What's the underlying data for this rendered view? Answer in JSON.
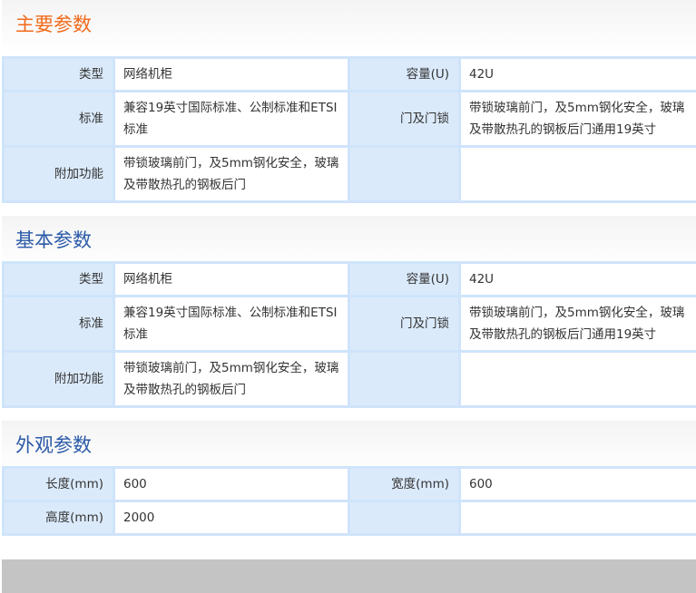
{
  "sections": [
    {
      "title": "主要参数",
      "rows": [
        {
          "label1": "类型",
          "value1": "网络机柜",
          "label2": "容量(U)",
          "value2": "42U"
        },
        {
          "label1": "标准",
          "value1": "兼容19英寸国际标准、公制标准和ETSI标准",
          "label2": "门及门锁",
          "value2": "带锁玻璃前门，及5mm钢化安全，玻璃及带散热孔的钢板后门通用19英寸"
        },
        {
          "label1": "附加功能",
          "value1": "带锁玻璃前门，及5mm钢化安全，玻璃及带散热孔的钢板后门",
          "label2": "",
          "value2": ""
        }
      ]
    },
    {
      "title": "基本参数",
      "rows": [
        {
          "label1": "类型",
          "value1": "网络机柜",
          "label2": "容量(U)",
          "value2": "42U"
        },
        {
          "label1": "标准",
          "value1": "兼容19英寸国际标准、公制标准和ETSI标准",
          "label2": "门及门锁",
          "value2": "带锁玻璃前门，及5mm钢化安全，玻璃及带散热孔的钢板后门通用19英寸"
        },
        {
          "label1": "附加功能",
          "value1": "带锁玻璃前门，及5mm钢化安全，玻璃及带散热孔的钢板后门",
          "label2": "",
          "value2": ""
        }
      ]
    },
    {
      "title": "外观参数",
      "rows": [
        {
          "label1": "长度(mm)",
          "value1": "600",
          "label2": "宽度(mm)",
          "value2": "600"
        },
        {
          "label1": "高度(mm)",
          "value1": "2000",
          "label2": "",
          "value2": ""
        }
      ]
    }
  ],
  "colors": {
    "title_primary": "#f26a1b",
    "title_secondary": "#2b5aa8",
    "label_bg": "#dbeafb",
    "border": "#cfe4fb"
  }
}
